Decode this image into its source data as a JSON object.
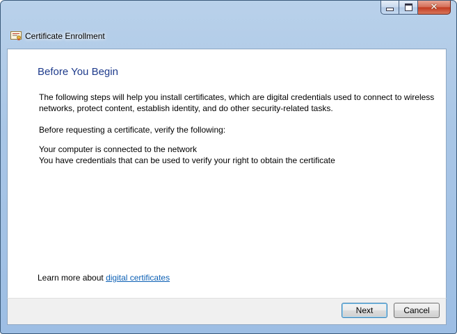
{
  "window": {
    "title": "Certificate Enrollment",
    "controls": {
      "minimize": "minimize",
      "maximize": "maximize",
      "close": "✕"
    }
  },
  "page": {
    "heading": "Before You Begin",
    "intro": "The following steps will help you install certificates, which are digital credentials used to connect to wireless networks, protect content, establish identity, and do other security-related tasks.",
    "verify_label": "Before requesting a certificate, verify the following:",
    "requirements": [
      "Your computer is connected to the network",
      "You have credentials that can be used to verify your right to obtain the certificate"
    ],
    "learn_more_prefix": "Learn more about ",
    "learn_more_link": "digital certificates"
  },
  "buttons": {
    "next": "Next",
    "cancel": "Cancel"
  }
}
